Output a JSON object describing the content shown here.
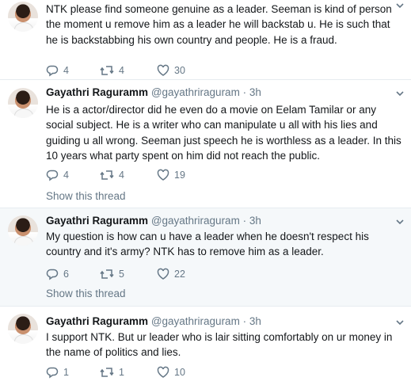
{
  "tweets": [
    {
      "name": "",
      "handle": "",
      "time": "",
      "text": "NTK please find someone genuine as a leader. Seeman is kind of person the moment u remove him as a leader he will backstab u. He is such that he is backstabbing his own country and people. He is a fraud.",
      "replies": "4",
      "retweets": "4",
      "likes": "30"
    },
    {
      "name": "Gayathri Raguramm",
      "handle": "@gayathriraguram",
      "time": "3h",
      "text": "He is a actor/director did he even do a movie on Eelam Tamilar or any social subject. He is a writer who can manipulate u all with his lies and guiding u all wrong. Seeman just speech he is worthless as a leader. In this 10 years what party spent on him did not reach the public.",
      "replies": "4",
      "retweets": "4",
      "likes": "19",
      "show_thread": "Show this thread"
    },
    {
      "name": "Gayathri Raguramm",
      "handle": "@gayathriraguram",
      "time": "3h",
      "text": "My question is how can u have a leader when he doesn't respect his country and it's army? NTK has to remove him as a leader.",
      "replies": "6",
      "retweets": "5",
      "likes": "22",
      "show_thread": "Show this thread"
    },
    {
      "name": "Gayathri Raguramm",
      "handle": "@gayathriraguram",
      "time": "3h",
      "text": "I support NTK. But ur leader who is lair sitting comfortably on ur money in the name of politics and lies.",
      "replies": "1",
      "retweets": "1",
      "likes": "10"
    }
  ],
  "separator": "·",
  "colors": {
    "text": "#14171a",
    "secondary": "#657786",
    "highlight_bg": "#f5f8fa",
    "divider": "#e6ecf0"
  },
  "icons": [
    "avatar",
    "chevron-down-icon",
    "reply-icon",
    "retweet-icon",
    "like-icon"
  ]
}
